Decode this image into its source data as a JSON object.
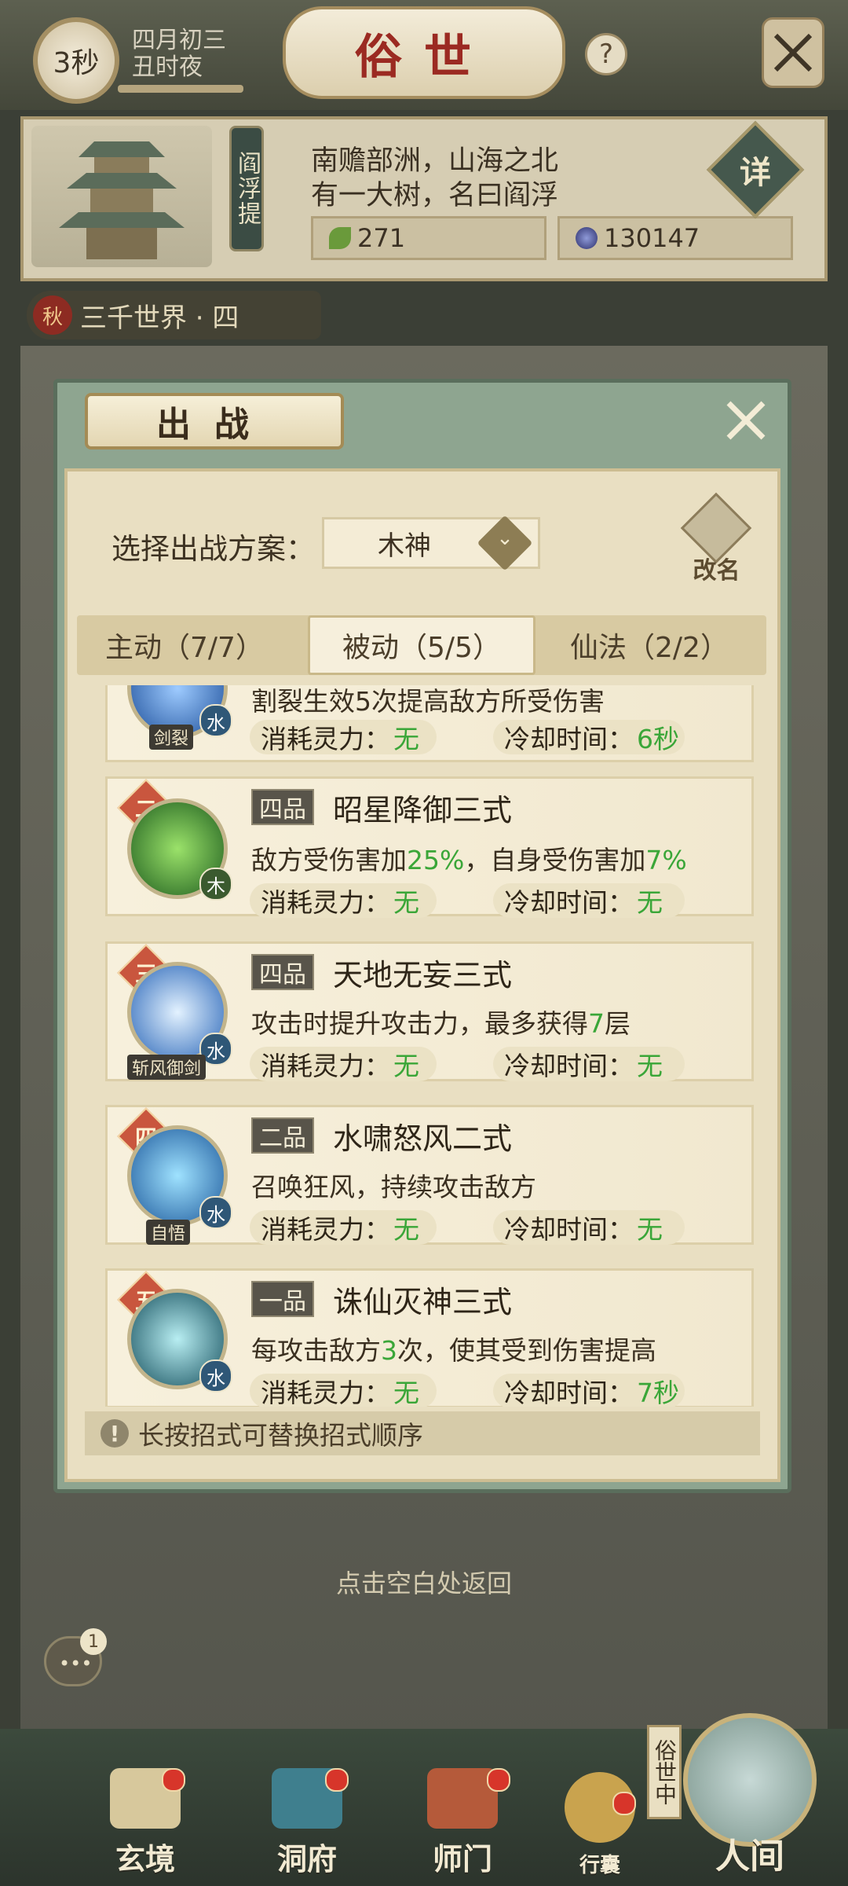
{
  "header": {
    "timer": "3秒",
    "date_line1": "四月初三",
    "date_line2": "丑时夜",
    "title": "俗世",
    "help_icon": "question-mark-icon",
    "close_icon": "crossed-swords-icon"
  },
  "info": {
    "location_name": "阎浮提",
    "line1": "南赡部洲，山海之北",
    "line2": "有一大树，名曰阎浮",
    "resource_leaf": "271",
    "resource_orb": "130147",
    "detail_label": "详"
  },
  "world": {
    "badge": "秋",
    "label": "三千世界 · 四"
  },
  "modal": {
    "title": "出战",
    "plan_label": "选择出战方案：",
    "plan_value": "木神",
    "rename_label": "改名",
    "tabs": [
      {
        "label": "主动（7/7）"
      },
      {
        "label": "被动（5/5）"
      },
      {
        "label": "仙法（2/2）"
      }
    ],
    "active_tab": 1,
    "cost_label": "消耗灵力：",
    "cooldown_label": "冷却时间：",
    "skills": [
      {
        "tag": "剑裂",
        "element": "水",
        "desc": "割裂生效5次提高敌方所受伤害",
        "cost": "无",
        "cooldown": "6秒"
      },
      {
        "rank": "二",
        "grade": "四品",
        "name": "昭星降御三式",
        "element": "木",
        "desc_a": "敌方受伤害加",
        "desc_b": "25%",
        "desc_c": "，自身受伤害加",
        "desc_d": "7%",
        "cost": "无",
        "cooldown": "无"
      },
      {
        "rank": "三",
        "grade": "四品",
        "name": "天地无妄三式",
        "element": "水",
        "tag": "斩风御剑",
        "desc_a": "攻击时提升攻击力，最多获得",
        "desc_b": "7",
        "desc_c": "层",
        "cost": "无",
        "cooldown": "无"
      },
      {
        "rank": "四",
        "grade": "二品",
        "name": "水啸怒风二式",
        "element": "水",
        "tag": "自悟",
        "desc": "召唤狂风，持续攻击敌方",
        "cost": "无",
        "cooldown": "无"
      },
      {
        "rank": "五",
        "grade": "一品",
        "name": "诛仙灭神三式",
        "element": "水",
        "desc_a": "每攻击敌方",
        "desc_b": "3",
        "desc_c": "次，使其受到伤害提高",
        "cost": "无",
        "cooldown": "7秒"
      }
    ],
    "tip": "长按招式可替换招式顺序"
  },
  "return_hint": "点击空白处返回",
  "chat_count": "1",
  "nav": [
    {
      "label": "玄境"
    },
    {
      "label": "洞府"
    },
    {
      "label": "师门"
    },
    {
      "label": "行囊"
    },
    {
      "label": "人间"
    }
  ],
  "suishi_tag": "俗世中",
  "colors": {
    "accent_red": "#9b2a22",
    "highlight_green": "#3aa638",
    "rank_orange": "#c9563e"
  }
}
